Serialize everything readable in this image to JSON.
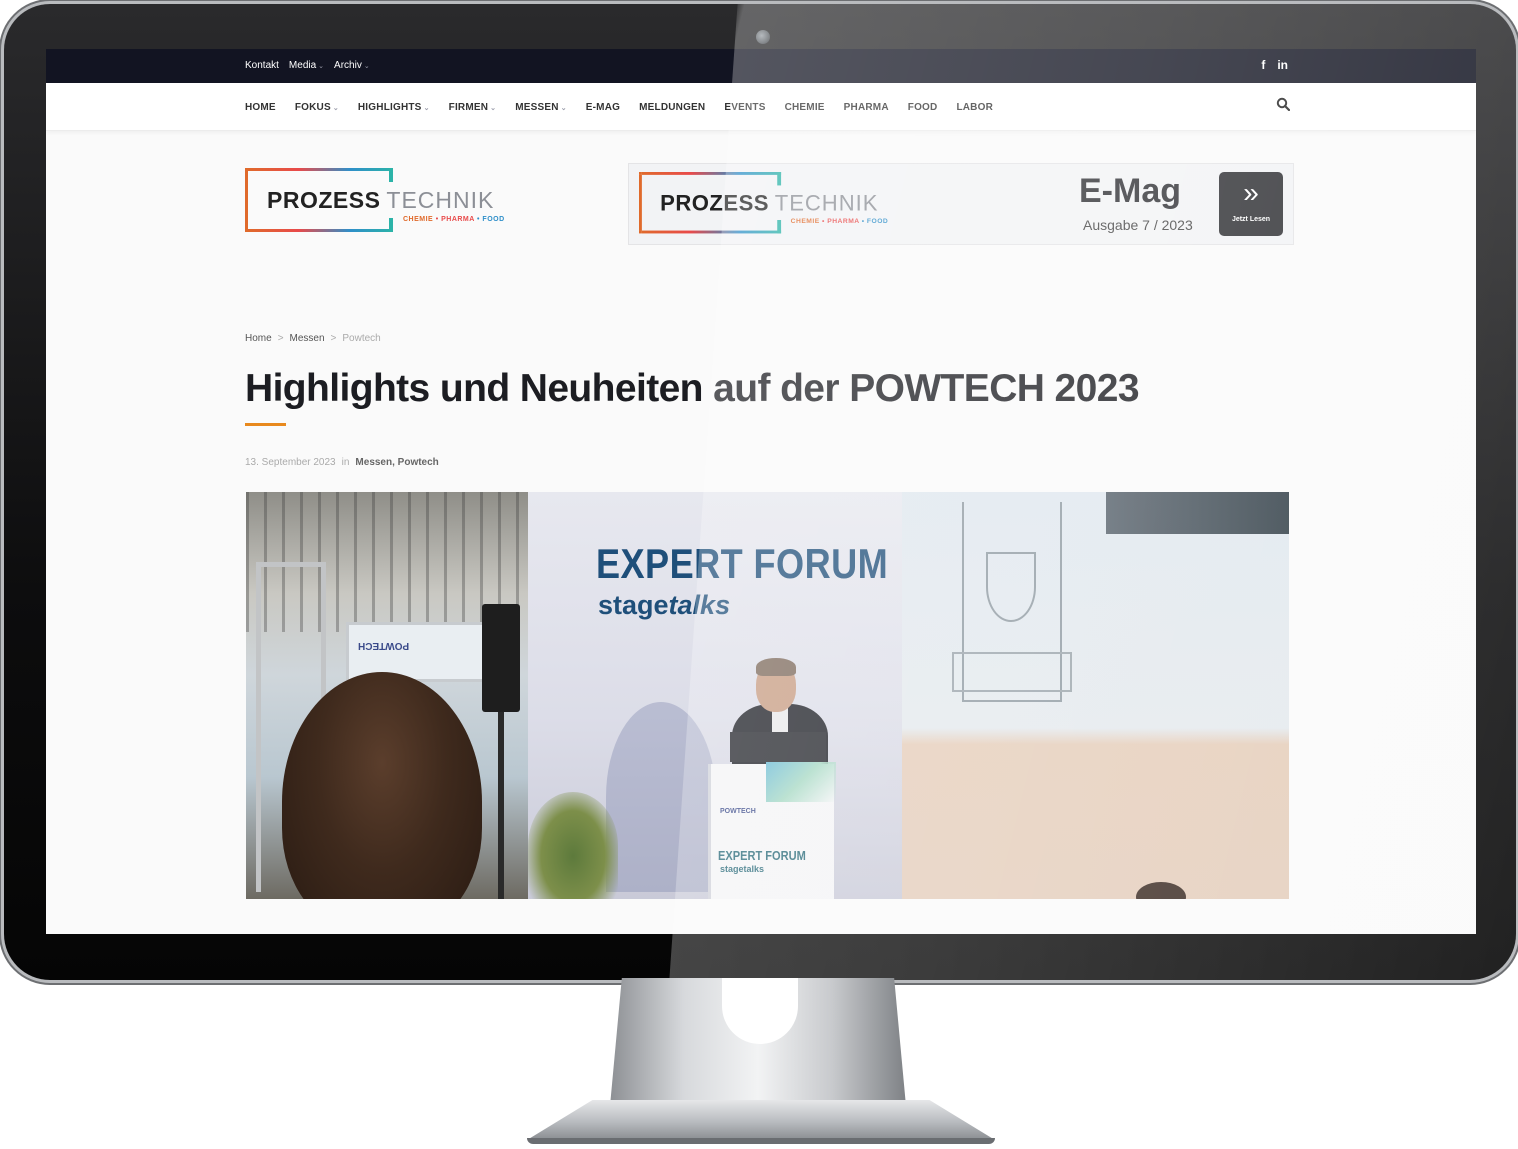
{
  "topbar": {
    "links": [
      {
        "label": "Kontakt",
        "has_dropdown": false
      },
      {
        "label": "Media",
        "has_dropdown": true
      },
      {
        "label": "Archiv",
        "has_dropdown": true
      }
    ],
    "social": {
      "facebook": "f",
      "linkedin": "in"
    }
  },
  "nav": {
    "items": [
      {
        "label": "HOME",
        "has_dropdown": false
      },
      {
        "label": "FOKUS",
        "has_dropdown": true
      },
      {
        "label": "HIGHLIGHTS",
        "has_dropdown": true
      },
      {
        "label": "FIRMEN",
        "has_dropdown": true
      },
      {
        "label": "MESSEN",
        "has_dropdown": true
      },
      {
        "label": "E-MAG",
        "has_dropdown": false
      },
      {
        "label": "MELDUNGEN",
        "has_dropdown": false
      },
      {
        "label": "EVENTS",
        "has_dropdown": false
      },
      {
        "label": "CHEMIE",
        "has_dropdown": false
      },
      {
        "label": "PHARMA",
        "has_dropdown": false
      },
      {
        "label": "FOOD",
        "has_dropdown": false
      },
      {
        "label": "LABOR",
        "has_dropdown": false
      }
    ],
    "search_icon": "search-icon"
  },
  "logo": {
    "word1": "PROZESS",
    "word2": "TECHNIK",
    "tagline": [
      "CHEMIE",
      "PHARMA",
      "FOOD"
    ],
    "tagline_sep": "•"
  },
  "banner": {
    "emag": "E-Mag",
    "issue": "Ausgabe 7 / 2023",
    "button_arrow": "»",
    "button_label": "Jetzt Lesen"
  },
  "breadcrumb": {
    "items": [
      "Home",
      "Messen",
      "Powtech"
    ],
    "separator": ">"
  },
  "article": {
    "title": "Highlights und Neuheiten auf der POWTECH 2023",
    "date": "13. September 2023",
    "in_label": "in",
    "categories": "Messen, Powtech"
  },
  "hero": {
    "forum_title": "EXPERT FORUM",
    "forum_sub_a": "stage",
    "forum_sub_b": "talks",
    "booth_sign": "POWTECH",
    "podium_logo": "POWTECH",
    "podium_title": "EXPERT FORUM",
    "podium_sub": "stagetalks"
  },
  "colors": {
    "topbar": "#121422",
    "accent": "#e8891d",
    "headline": "#1c1d22",
    "forum_blue": "#1f4f7a"
  }
}
